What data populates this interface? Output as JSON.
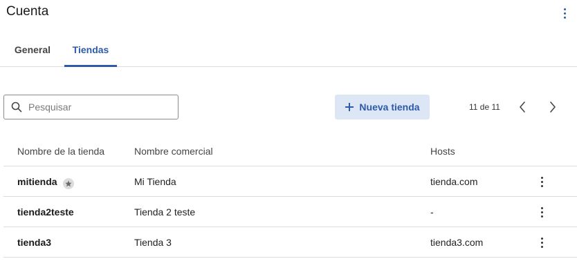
{
  "header": {
    "title": "Cuenta"
  },
  "tabs": [
    {
      "label": "General",
      "active": false
    },
    {
      "label": "Tiendas",
      "active": true
    }
  ],
  "toolbar": {
    "search_placeholder": "Pesquisar",
    "search_value": "",
    "new_store_label": "Nueva tienda",
    "pager_text": "11 de 11"
  },
  "table": {
    "columns": [
      "Nombre de la tienda",
      "Nombre comercial",
      "Hosts"
    ],
    "rows": [
      {
        "name": "mitienda",
        "commercial_name": "Mi Tienda",
        "host": "tienda.com",
        "starred": true
      },
      {
        "name": "tienda2teste",
        "commercial_name": "Tienda 2 teste",
        "host": "-",
        "starred": false
      },
      {
        "name": "tienda3",
        "commercial_name": "Tienda 3",
        "host": "tienda3.com",
        "starred": false
      }
    ]
  },
  "colors": {
    "accent": "#2d5aa8",
    "button_bg": "#dde6f5",
    "divider": "#dcdcdc"
  },
  "icons": [
    "kebab-menu-icon",
    "search-icon",
    "plus-icon",
    "chevron-left-icon",
    "chevron-right-icon",
    "star-icon"
  ]
}
